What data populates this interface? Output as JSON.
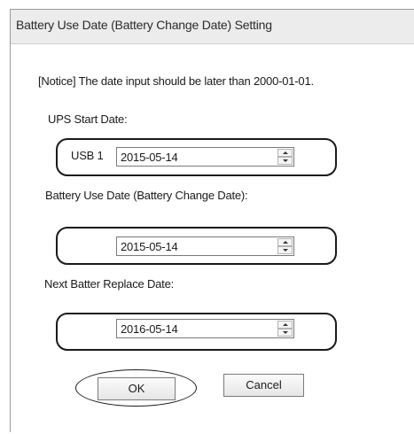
{
  "window": {
    "title": "Battery Use Date (Battery Change Date) Setting"
  },
  "notice": "[Notice] The date input should be later than 2000-01-01.",
  "ups_start": {
    "label": "UPS Start Date:",
    "device_label": "USB 1",
    "value": "2015-05-14"
  },
  "battery_use": {
    "label": "Battery Use Date (Battery Change Date):",
    "value": "2015-05-14"
  },
  "next_replace": {
    "label": "Next Batter Replace Date:",
    "value": "2016-05-14"
  },
  "buttons": {
    "ok": "OK",
    "cancel": "Cancel"
  }
}
